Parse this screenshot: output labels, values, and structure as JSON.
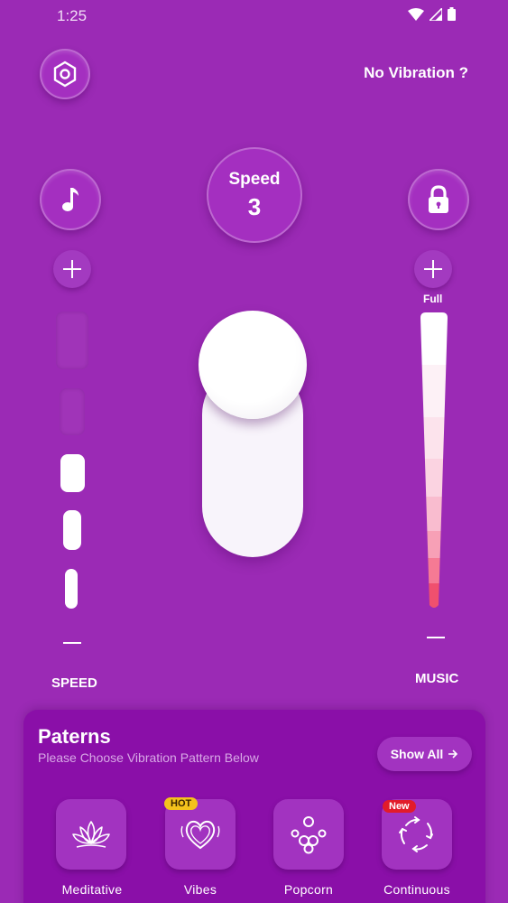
{
  "status_bar": {
    "time": "1:25"
  },
  "header": {
    "no_vibration": "No Vibration ?"
  },
  "speed": {
    "label": "Speed",
    "value": "3"
  },
  "left_control": {
    "caption": "SPEED",
    "level": 3,
    "max_level": 5
  },
  "right_control": {
    "caption": "MUSIC",
    "top_label": "Full"
  },
  "slider": {
    "value": 3
  },
  "patterns": {
    "title": "Paterns",
    "subtitle": "Please Choose Vibration Pattern Below",
    "show_all": "Show All",
    "items": [
      {
        "label": "Meditative",
        "icon": "lotus-icon",
        "badge": ""
      },
      {
        "label": "Vibes",
        "icon": "heart-icon",
        "badge": "HOT"
      },
      {
        "label": "Popcorn",
        "icon": "popcorn-icon",
        "badge": ""
      },
      {
        "label": "Continuous",
        "icon": "loop-icon",
        "badge": "New"
      }
    ]
  },
  "colors": {
    "background": "#9b2ab5",
    "panel": "#8a0fa8",
    "hot_badge": "#f4c21c",
    "new_badge": "#e21b2a",
    "music_level_bottom": "#f0506e"
  }
}
